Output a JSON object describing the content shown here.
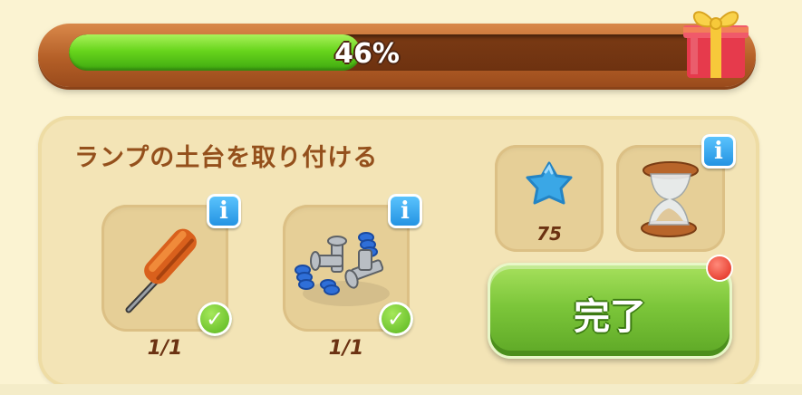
{
  "progress": {
    "value_percent": 46,
    "label": "46%"
  },
  "task": {
    "title": "ランプの土台を取り付ける",
    "items": [
      {
        "name": "screwdriver",
        "icon": "screwdriver-icon",
        "count": "1/1",
        "completed": true
      },
      {
        "name": "bolts-and-springs",
        "icon": "bolts-icon",
        "count": "1/1",
        "completed": true
      }
    ]
  },
  "reward": {
    "icon": "blue-star-icon",
    "value": "75"
  },
  "timer": {
    "icon": "hourglass-icon"
  },
  "buttons": {
    "complete_label": "完了"
  },
  "colors": {
    "progress_fill": "#68d51c",
    "bar_frame": "#b45f27",
    "panel_bg": "#f3e4b6",
    "title_text": "#94501c",
    "button_green": "#7cc63a",
    "info_blue": "#1f8fe0",
    "notification_red": "#e0281a"
  }
}
